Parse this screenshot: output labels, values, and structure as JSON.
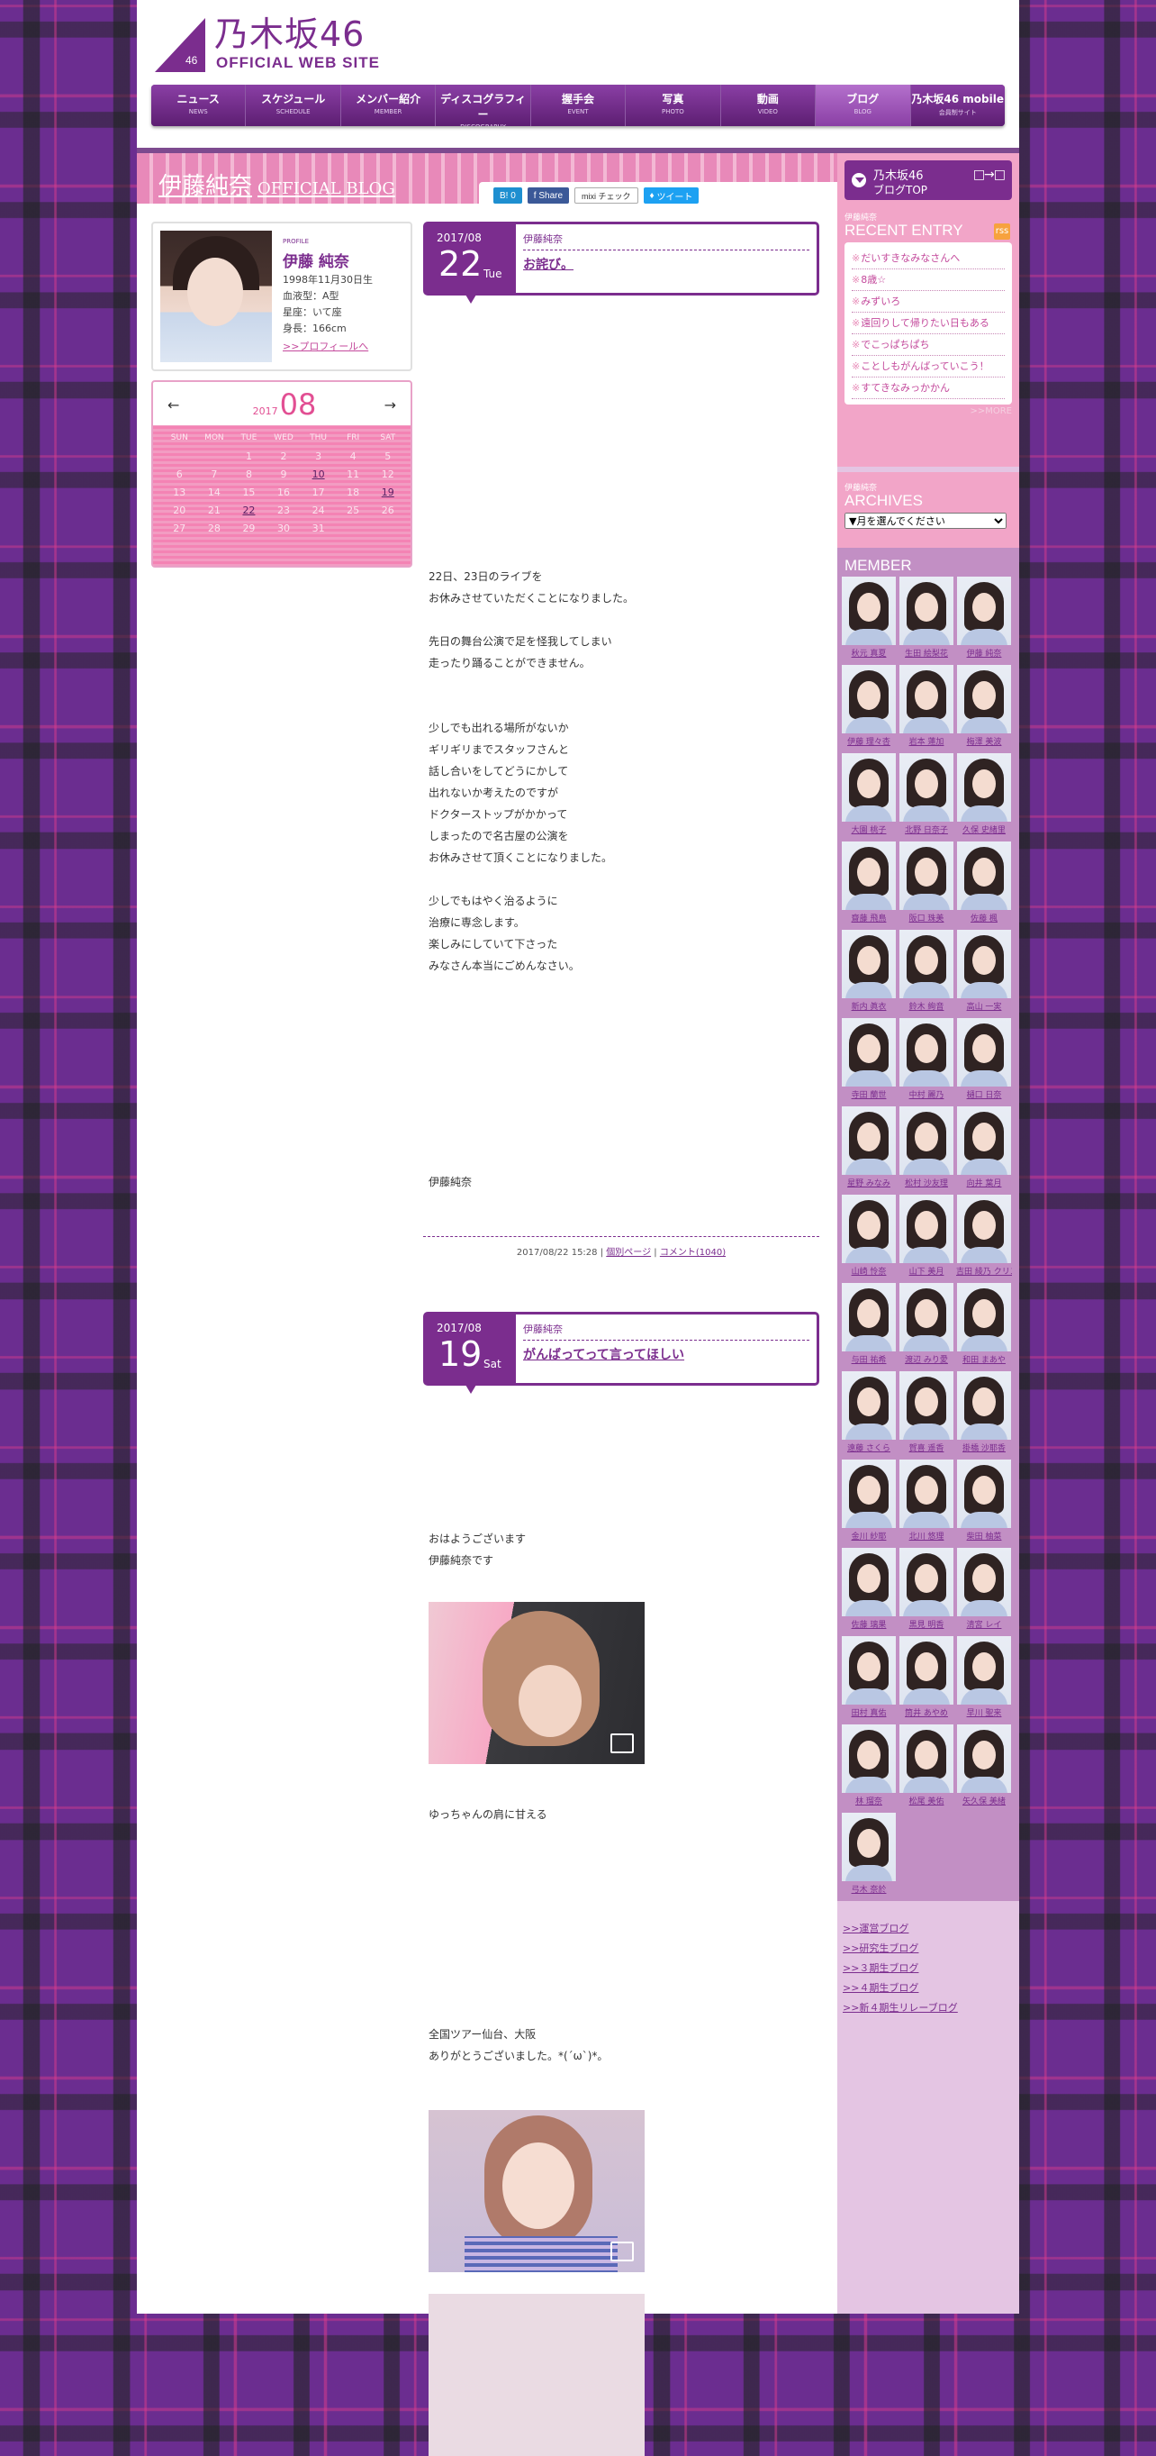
{
  "site": {
    "logo_jp": "乃木坂46",
    "logo_en": "OFFICIAL WEB SITE",
    "logo_badge": "46"
  },
  "nav": [
    {
      "jp": "ニュース",
      "en": "NEWS"
    },
    {
      "jp": "スケジュール",
      "en": "SCHEDULE"
    },
    {
      "jp": "メンバー紹介",
      "en": "MEMBER"
    },
    {
      "jp": "ディスコグラフィー",
      "en": "DISCOGRAPHY"
    },
    {
      "jp": "握手会",
      "en": "EVENT"
    },
    {
      "jp": "写真",
      "en": "PHOTO"
    },
    {
      "jp": "動画",
      "en": "VIDEO"
    },
    {
      "jp": "ブログ",
      "en": "BLOG"
    },
    {
      "jp": "乃木坂46 mobile",
      "en": "会員制サイト"
    }
  ],
  "blog": {
    "title": "伊藤純奈",
    "subtitle": "OFFICIAL BLOG"
  },
  "share": {
    "hatena": "B! 0",
    "facebook": "Share",
    "mixi": "mixi チェック",
    "twitter": "ツイート"
  },
  "profile": {
    "label": "PROFILE",
    "name": "伊藤 純奈",
    "birthday": "1998年11月30日生",
    "blood": "血液型：A型",
    "sign": "星座：いて座",
    "height": "身長：166cm",
    "link": ">>プロフィールへ"
  },
  "calendar": {
    "year": "2017",
    "month": "08",
    "prev": "←",
    "next": "→",
    "weekdays": [
      "SUN",
      "MON",
      "TUE",
      "WED",
      "THU",
      "FRI",
      "SAT"
    ],
    "weeks": [
      [
        "",
        "",
        "1",
        "2",
        "3",
        "4",
        "5"
      ],
      [
        "6",
        "7",
        "8",
        "9",
        "10",
        "11",
        "12"
      ],
      [
        "13",
        "14",
        "15",
        "16",
        "17",
        "18",
        "19"
      ],
      [
        "20",
        "21",
        "22",
        "23",
        "24",
        "25",
        "26"
      ],
      [
        "27",
        "28",
        "29",
        "30",
        "31",
        "",
        ""
      ]
    ],
    "links": [
      "10",
      "19",
      "22"
    ]
  },
  "entries": [
    {
      "ym": "2017/08",
      "day": "22",
      "wday": "Tue",
      "author": "伊藤純奈",
      "title": "お詫び。",
      "para1": [
        "22日、23日のライブを",
        "お休みさせていただくことになりました。"
      ],
      "para2": [
        "先日の舞台公演で足を怪我してしまい",
        "走ったり踊ることができません。"
      ],
      "para3": [
        "少しでも出れる場所がないか",
        "ギリギリまでスタッフさんと",
        "話し合いをしてどうにかして",
        "出れないか考えたのですが",
        "ドクターストップがかかって",
        "しまったので名古屋の公演を",
        "お休みさせて頂くことになりました。"
      ],
      "para4": [
        "少しでもはやく治るように",
        "治療に専念します。",
        "楽しみにしていて下さった",
        "みなさん本当にごめんなさい。"
      ],
      "sign": "伊藤純奈",
      "footer": {
        "time": "2017/08/22 15:28",
        "sep": "|",
        "page": "個別ページ",
        "comments": "コメント(1040)"
      }
    },
    {
      "ym": "2017/08",
      "day": "19",
      "wday": "Sat",
      "author": "伊藤純奈",
      "title": "がんばってって言ってほしい",
      "para1": [
        "おはようございます",
        "伊藤純奈です"
      ],
      "caption1": "ゆっちゃんの肩に甘える",
      "para2": [
        "全国ツアー仙台、大阪",
        "ありがとうございました。*(´ω`)*。"
      ]
    }
  ],
  "sidebar": {
    "top_line1": "乃木坂46",
    "top_line2": "ブログTOP",
    "top_arrow": "□→□",
    "recent_small": "伊藤純奈",
    "recent_label": "RECENT ENTRY",
    "rss": "rss",
    "recent": [
      "だいすきなみなさんへ",
      "8歳☆",
      "みずいろ",
      "遠回りして帰りたい日もある",
      "でこっぱちぱち",
      "ことしもがんばっていこう！",
      "すてきなみっかかん"
    ],
    "more": ">>MORE",
    "archives_small": "伊藤純奈",
    "archives_label": "ARCHIVES",
    "archives_select": "▼月を選んでください",
    "member_label": "MEMBER",
    "members": [
      "秋元 真夏",
      "生田 絵梨花",
      "伊藤 純奈",
      "伊藤 理々杏",
      "岩本 蓮加",
      "梅澤 美波",
      "大園 桃子",
      "北野 日奈子",
      "久保 史緒里",
      "齋藤 飛鳥",
      "阪口 珠美",
      "佐藤 楓",
      "新内 眞衣",
      "鈴木 絢音",
      "高山 一実",
      "寺田 蘭世",
      "中村 麗乃",
      "樋口 日奈",
      "星野 みなみ",
      "松村 沙友理",
      "向井 葉月",
      "山崎 怜奈",
      "山下 美月",
      "吉田 綾乃 クリスティー",
      "与田 祐希",
      "渡辺 みり愛",
      "和田 まあや",
      "遠藤 さくら",
      "賀喜 遥香",
      "掛橋 沙耶香",
      "金川 紗耶",
      "北川 悠理",
      "柴田 柚菜",
      "佐藤 璃果",
      "黒見 明香",
      "清宮 レイ",
      "田村 真佑",
      "筒井 あやめ",
      "早川 聖来",
      "林 瑠奈",
      "松尾 美佑",
      "矢久保 美緒",
      "弓木 奈於"
    ],
    "links": [
      ">>運営ブログ",
      ">>研究生ブログ",
      ">>３期生ブログ",
      ">>４期生ブログ",
      ">>新４期生リレーブログ"
    ]
  },
  "colors": {
    "purple": "#7b2d8e",
    "pink": "#f2a5c8",
    "accent_pink": "#e24f93"
  }
}
